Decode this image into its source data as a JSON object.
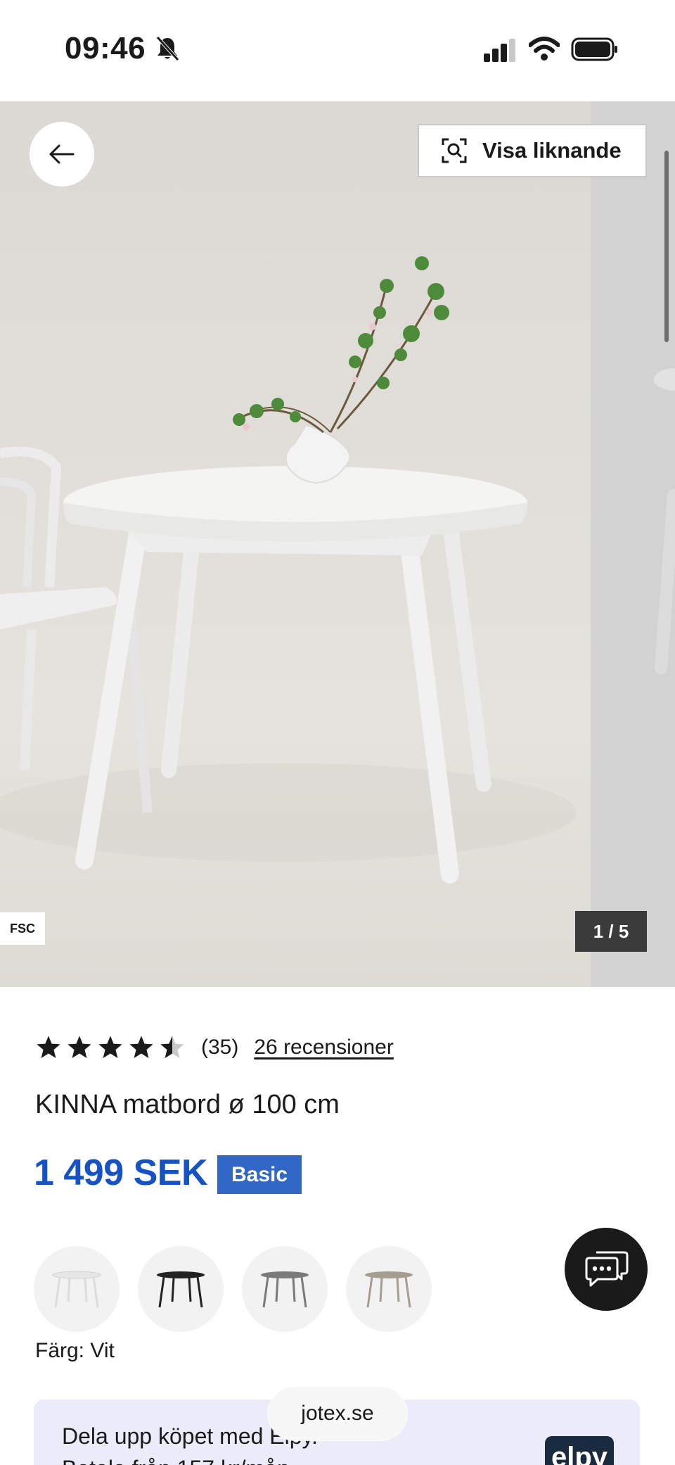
{
  "status_bar": {
    "time": "09:46"
  },
  "gallery": {
    "back_icon": "arrow-left-icon",
    "similar_label": "Visa liknande",
    "similar_icon": "visual-search-icon",
    "fsc_label": "FSC",
    "counter": "1 / 5"
  },
  "product": {
    "rating_value": 4.5,
    "rating_max": 5,
    "rating_count": "(35)",
    "reviews_link": "26 recensioner",
    "title": "KINNA matbord ø 100 cm",
    "price": "1 499 SEK",
    "badge": "Basic",
    "color_label": "Färg: Vit",
    "swatches": [
      {
        "name": "Vit",
        "color": "#e9e9e9"
      },
      {
        "name": "Svart",
        "color": "#222222"
      },
      {
        "name": "Grå",
        "color": "#7a7a7a"
      },
      {
        "name": "Beige",
        "color": "#a59d8f"
      }
    ]
  },
  "installment": {
    "line1": "Dela upp köpet med Elpy.",
    "line2": "Betala från 157 kr/mån",
    "logo": "elpy"
  },
  "browser": {
    "url": "jotex.se"
  },
  "colors": {
    "price_blue": "#1652c4",
    "badge_blue": "#3168c6",
    "installment_bg": "#ebebfa"
  }
}
